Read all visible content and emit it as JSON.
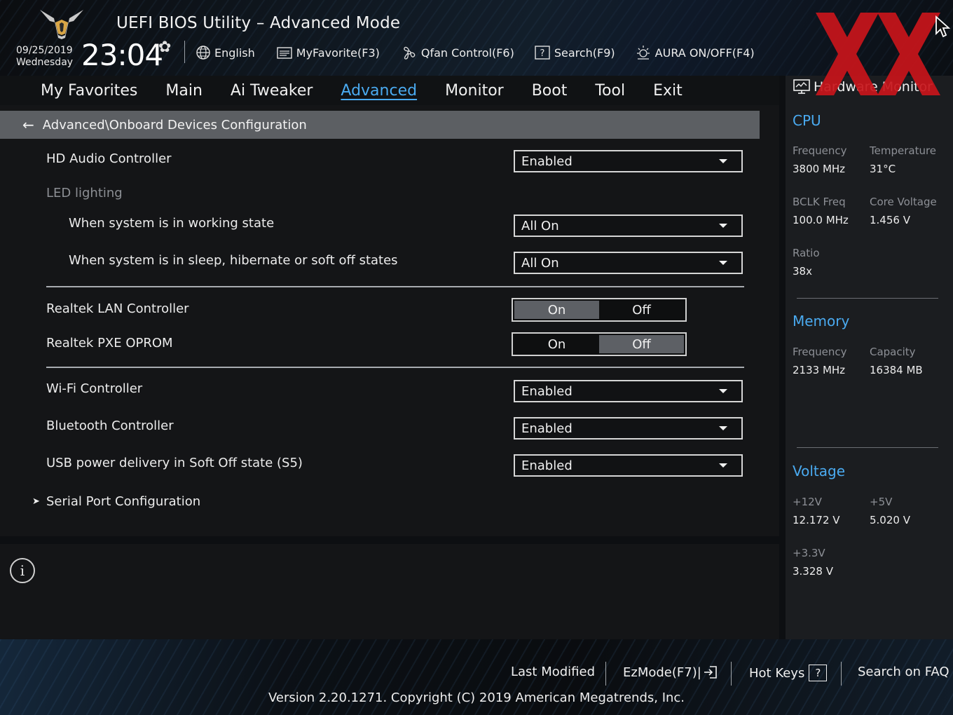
{
  "header": {
    "title": "UEFI BIOS Utility – Advanced Mode",
    "date": "09/25/2019",
    "weekday": "Wednesday",
    "time": "23:04",
    "tools": [
      {
        "label": "English",
        "icon": "globe-icon"
      },
      {
        "label": "MyFavorite(F3)",
        "icon": "favorite-list-icon"
      },
      {
        "label": "Qfan Control(F6)",
        "icon": "fan-icon"
      },
      {
        "label": "Search(F9)",
        "icon": "search-help-icon"
      },
      {
        "label": "AURA ON/OFF(F4)",
        "icon": "aura-light-icon"
      }
    ]
  },
  "menu": {
    "items": [
      "My Favorites",
      "Main",
      "Ai Tweaker",
      "Advanced",
      "Monitor",
      "Boot",
      "Tool",
      "Exit"
    ],
    "active": "Advanced"
  },
  "breadcrumb": {
    "path": "Advanced\\Onboard Devices Configuration"
  },
  "settings": {
    "hd_audio": {
      "label": "HD Audio Controller",
      "value": "Enabled"
    },
    "led_heading": "LED lighting",
    "led_working": {
      "label": "When system is in working state",
      "value": "All On"
    },
    "led_sleep": {
      "label": "When system is in sleep, hibernate or soft off states",
      "value": "All On"
    },
    "lan": {
      "label": "Realtek LAN Controller",
      "on": "On",
      "off": "Off",
      "selected": "On"
    },
    "pxe": {
      "label": "Realtek PXE OPROM",
      "on": "On",
      "off": "Off",
      "selected": "Off"
    },
    "wifi": {
      "label": "Wi-Fi Controller",
      "value": "Enabled"
    },
    "bluetooth": {
      "label": "Bluetooth Controller",
      "value": "Enabled"
    },
    "usb_power": {
      "label": "USB power delivery in Soft Off state (S5)",
      "value": "Enabled"
    },
    "serial_port": {
      "label": "Serial Port Configuration"
    }
  },
  "hardware_monitor": {
    "title": "Hardware Monitor",
    "cpu": {
      "heading": "CPU",
      "frequency_label": "Frequency",
      "frequency": "3800 MHz",
      "temperature_label": "Temperature",
      "temperature": "31°C",
      "bclk_label": "BCLK Freq",
      "bclk": "100.0 MHz",
      "core_voltage_label": "Core Voltage",
      "core_voltage": "1.456 V",
      "ratio_label": "Ratio",
      "ratio": "38x"
    },
    "memory": {
      "heading": "Memory",
      "frequency_label": "Frequency",
      "frequency": "2133 MHz",
      "capacity_label": "Capacity",
      "capacity": "16384 MB"
    },
    "voltage": {
      "heading": "Voltage",
      "v12_label": "+12V",
      "v12": "12.172 V",
      "v5_label": "+5V",
      "v5": "5.020 V",
      "v33_label": "+3.3V",
      "v33": "3.328 V"
    }
  },
  "footer": {
    "last_modified": "Last Modified",
    "ezmode": "EzMode(F7)|",
    "hot_keys": "Hot Keys",
    "hot_keys_key": "?",
    "search_faq": "Search on FAQ",
    "version": "Version 2.20.1271. Copyright (C) 2019 American Megatrends, Inc."
  },
  "colors": {
    "accent": "#4aaaf0",
    "breadcrumb_bg": "#5c5f63",
    "watermark": "#c8151b"
  }
}
